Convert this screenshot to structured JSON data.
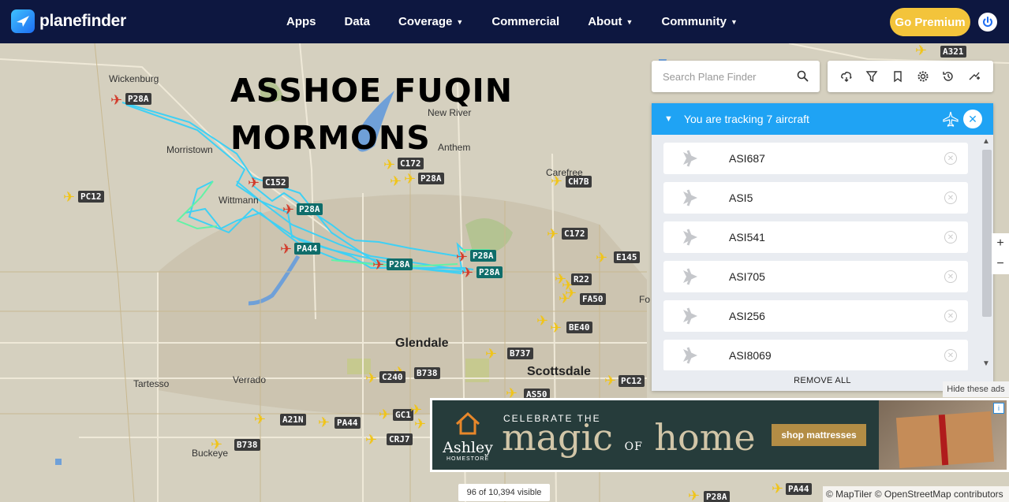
{
  "app": {
    "logo_text": "planefinder",
    "premium_label": "Go Premium"
  },
  "nav": {
    "items": [
      {
        "label": "Apps",
        "dropdown": false
      },
      {
        "label": "Data",
        "dropdown": false
      },
      {
        "label": "Coverage",
        "dropdown": true
      },
      {
        "label": "Commercial",
        "dropdown": false
      },
      {
        "label": "About",
        "dropdown": true
      },
      {
        "label": "Community",
        "dropdown": true
      }
    ]
  },
  "overlay_text": {
    "line1": "ASSHOE FUQIN",
    "line2": "MORMONS"
  },
  "search": {
    "placeholder": "Search Plane Finder"
  },
  "toolbar": {
    "icons": [
      "weather-icon",
      "filter-icon",
      "bookmark-icon",
      "settings-icon",
      "history-icon",
      "playback-icon"
    ]
  },
  "tracking": {
    "title": "You are tracking 7 aircraft",
    "aircraft": [
      "ASI687",
      "ASI5",
      "ASI541",
      "ASI705",
      "ASI256",
      "ASI8069"
    ],
    "remove_all": "REMOVE ALL"
  },
  "map": {
    "places": {
      "wickenburg": "Wickenburg",
      "morristown": "Morristown",
      "wittmann": "Wittmann",
      "new_river": "New River",
      "anthem": "Anthem",
      "carefree": "Carefree",
      "glendale": "Glendale",
      "scottsdale": "Scottsdale",
      "tartesso": "Tartesso",
      "verrado": "Verrado",
      "buckeye": "Buckeye",
      "fo": "Fo"
    },
    "tags": {
      "p28a_1": "P28A",
      "pc12_1": "PC12",
      "c152": "C152",
      "p28a_2": "P28A",
      "pa44_1": "PA44",
      "p28a_3": "P28A",
      "p28a_4": "P28A",
      "p28a_5": "P28A",
      "c172_1": "C172",
      "p28a_6": "P28A",
      "ch7b": "CH7B",
      "c172_2": "C172",
      "e145": "E145",
      "r22": "R22",
      "fa50": "FA50",
      "be40": "BE40",
      "b737": "B737",
      "b738_1": "B738",
      "c240": "C240",
      "pc12_2": "PC12",
      "as50": "AS50",
      "gc1": "GC1",
      "a21n": "A21N",
      "pa44_2": "PA44",
      "crj7": "CRJ7",
      "b738_2": "B738",
      "a321": "A321",
      "pa44_3": "PA44",
      "p28a_7": "P28A"
    },
    "visible_count": "96 of 10,394 visible",
    "attribution": "© MapTiler © OpenStreetMap contributors"
  },
  "ad": {
    "hide_label": "Hide these ads",
    "brand": "Ashley",
    "brand_sub": "HOMESTORE",
    "celebrate": "CELEBRATE THE",
    "magic": "magic",
    "of": "OF",
    "home": "home",
    "cta": "shop mattresses"
  },
  "colors": {
    "nav_bg": "#0d1740",
    "premium": "#f3c43b",
    "panel_header": "#1fa3f4",
    "track": "#3fd0f4"
  }
}
